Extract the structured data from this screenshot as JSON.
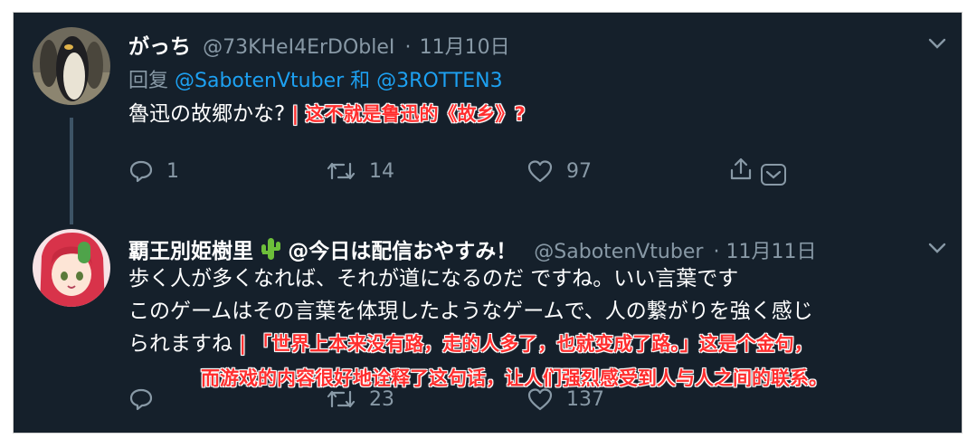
{
  "colors": {
    "background": "#15202b",
    "text": "#ffffff",
    "muted": "#8899a6",
    "link": "#1da1f2",
    "annotation": "#ff2e2e"
  },
  "tweet1": {
    "display_name": "がっち",
    "handle": "@73KHeI4ErDObleI",
    "date": "11月10日",
    "reply_prefix": "回复",
    "reply_to_1": "@SabotenVtuber",
    "reply_and": "和",
    "reply_to_2": "@3ROTTEN3",
    "text": "魯迅の故郷かな?",
    "annotation": "这不就是鲁迅的《故乡》?",
    "reply_count": "1",
    "retweet_count": "14",
    "like_count": "97",
    "icons": [
      "reply-icon",
      "retweet-icon",
      "like-icon",
      "share-icon",
      "chevron-down-icon"
    ]
  },
  "tweet2": {
    "display_name": "覇王別姫樹里",
    "display_name_suffix": "@今日は配信おやすみ！",
    "name_emoji": "cactus-icon",
    "handle": "@SabotenVtuber",
    "date": "· 11月11日",
    "line1": "歩く人が多くなれば、それが道になるのだ ですね。いい言葉です",
    "line2": "このゲームはその言葉を体現したようなゲームで、人の繋がりを強く感じ",
    "line3": "られますね",
    "annotation_line1": "「世界上本来没有路，走的人多了，也就变成了路。」这是个金句，",
    "annotation_line2": "而游戏的内容很好地诠释了这句话，让人们强烈感受到人与人之间的联系。",
    "retweet_count": "23",
    "like_count": "137",
    "icons": [
      "reply-icon",
      "retweet-icon",
      "like-icon",
      "chevron-down-icon"
    ]
  }
}
